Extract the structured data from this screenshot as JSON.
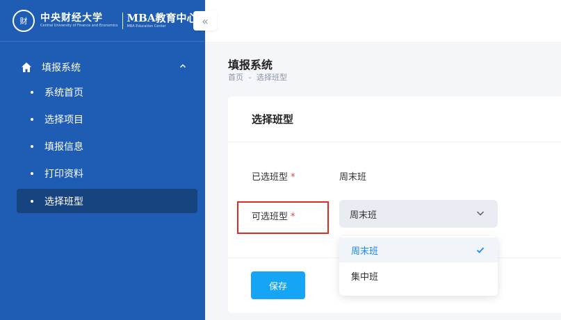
{
  "logo": {
    "seal": "财",
    "university": "中央财经大学",
    "university_en": "Central University of Finance and Economics",
    "center": "MBA教育中心",
    "center_en": "MBA Education Center"
  },
  "sidebar": {
    "collapse_icon": "«",
    "group": {
      "label": "填报系统",
      "icon": "home-icon",
      "chevron": "^"
    },
    "items": [
      {
        "label": "系统首页"
      },
      {
        "label": "选择项目"
      },
      {
        "label": "填报信息"
      },
      {
        "label": "打印资料"
      },
      {
        "label": "选择班型"
      }
    ],
    "colors": {
      "bg": "#1e5db3",
      "active": "#17437f"
    }
  },
  "main": {
    "title": "填报系统",
    "breadcrumb": {
      "home": "首页",
      "sep": "-",
      "current": "选择班型"
    },
    "card_title": "选择班型",
    "selected_label": "已选班型",
    "selected_value": "周末班",
    "choose_label": "可选班型",
    "required_mark": "*",
    "select_value": "周末班",
    "options": [
      {
        "label": "周末班",
        "selected": true
      },
      {
        "label": "集中班",
        "selected": false
      }
    ],
    "save_label": "保存",
    "colors": {
      "primary": "#16a4f5",
      "option_selected": "#1989fa",
      "required": "#e0473d",
      "highlight": "#e02a1f"
    }
  }
}
